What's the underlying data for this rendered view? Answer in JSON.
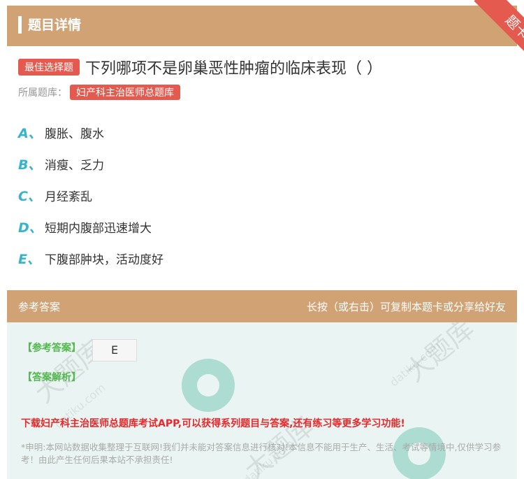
{
  "header": {
    "title": "题目详情",
    "ribbon_text": "题卡"
  },
  "question": {
    "type_badge": "最佳选择题",
    "text": "下列哪项不是卵巢恶性肿瘤的临床表现（ ）",
    "category_label": "所属题库：",
    "category_value": "妇产科主治医师总题库"
  },
  "options": [
    {
      "letter": "A、",
      "text": "腹胀、腹水"
    },
    {
      "letter": "B、",
      "text": "消瘦、乏力"
    },
    {
      "letter": "C、",
      "text": "月经紊乱"
    },
    {
      "letter": "D、",
      "text": "短期内腹部迅速增大"
    },
    {
      "letter": "E、",
      "text": "下腹部肿块，活动度好"
    }
  ],
  "answer_section": {
    "title": "参考答案",
    "tip": "长按（或右击）可复制本题卡或分享给好友",
    "ref_label": "【参考答案】",
    "ref_value": "E",
    "explain_label": "【答案解析】",
    "promo": "下载妇产科主治医师总题库考试APP,可以获得系列题目与答案,还有练习等更多学习功能!",
    "disclaimer": "*申明:本网站数据收集整理于互联网!我们并未能对答案信息进行核对!本信息不能用于生产、生活、考试等情境中,仅供学习参考！由此产生任何后果本站不承担责任!"
  },
  "watermark": {
    "text": "大题库",
    "domain": "datiku.com"
  },
  "colors": {
    "header_bg": "#d0a274",
    "accent_red": "#e55a4e",
    "option_letter": "#37b4c8",
    "answer_green": "#52b84e",
    "promo_red": "#e8282a",
    "answer_bg": "#eaf5f3"
  }
}
